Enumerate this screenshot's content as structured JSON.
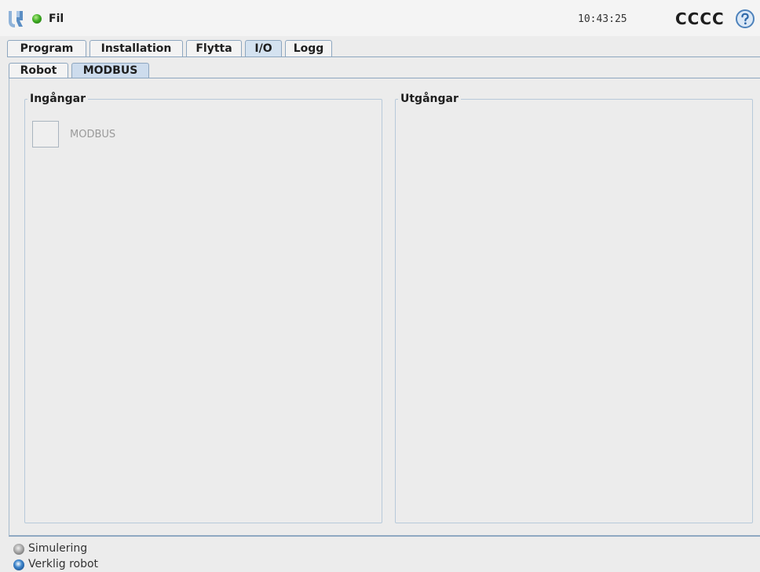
{
  "topbar": {
    "file_label": "Fil",
    "time": "10:43:25",
    "robot_name": "CCCC",
    "status_color": "#3fae23",
    "logo_icon": "ur-logo-icon",
    "help_icon": "help-icon"
  },
  "main_tabs": [
    {
      "label": "Program",
      "active": false
    },
    {
      "label": "Installation",
      "active": false
    },
    {
      "label": "Flytta",
      "active": false
    },
    {
      "label": "I/O",
      "active": true
    },
    {
      "label": "Logg",
      "active": false
    }
  ],
  "sub_tabs": [
    {
      "label": "Robot",
      "active": false
    },
    {
      "label": "MODBUS",
      "active": true
    }
  ],
  "inputs": {
    "title": "Ingångar",
    "items": [
      {
        "label": "MODBUS",
        "checked": false
      }
    ]
  },
  "outputs": {
    "title": "Utgångar",
    "items": []
  },
  "modes": {
    "simulation": "Simulering",
    "real_robot": "Verklig robot",
    "selected": "real_robot"
  },
  "colors": {
    "accent": "#8da6bf",
    "active_tab": "#d4e2f0"
  }
}
